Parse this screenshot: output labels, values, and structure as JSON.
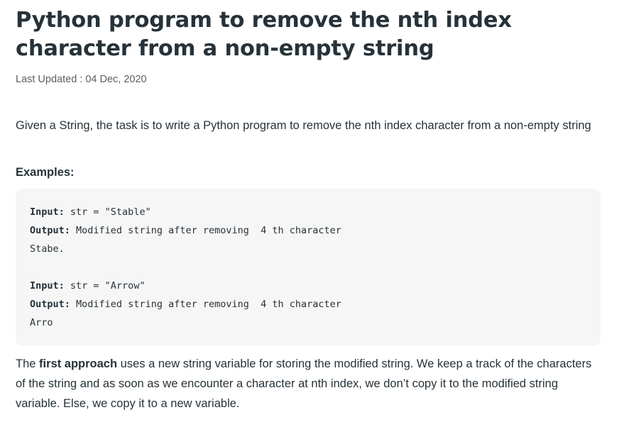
{
  "article": {
    "title": "Python program to remove the nth index character from a non-empty string",
    "last_updated": "Last Updated : 04 Dec, 2020",
    "intro": "Given a String, the task is to write a Python program to remove the nth index character from a non-empty string",
    "examples_heading": "Examples:",
    "examples": [
      {
        "input_label": "Input:",
        "input_value": " str = \"Stable\"",
        "output_label": "Output:",
        "output_value": " Modified string after removing  4 th character",
        "result": "Stabe."
      },
      {
        "input_label": "Input:",
        "input_value": " str = \"Arrow\"",
        "output_label": "Output:",
        "output_value": " Modified string after removing  4 th character",
        "result": "Arro"
      }
    ],
    "approach": {
      "prefix": "The ",
      "bold": "first approach",
      "suffix": " uses a new string variable for storing the modified string. We keep a track of the characters of the string and as soon as we encounter a character at nth index, we don’t copy it to the modified string variable. Else, we copy it to a new variable."
    }
  }
}
